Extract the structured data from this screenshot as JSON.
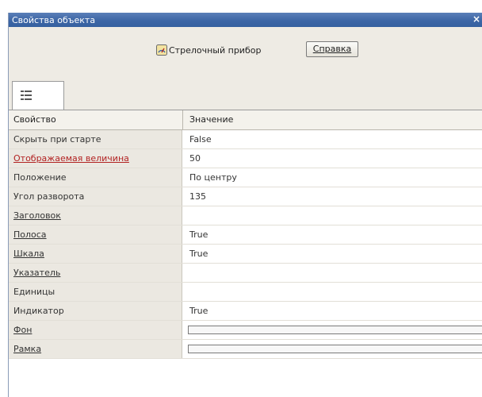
{
  "window": {
    "title": "Свойства объекта",
    "close_glyph": "×"
  },
  "header": {
    "object_label": "Стрелочный прибор",
    "help_label": "Справка",
    "object_icon": "gauge-icon"
  },
  "tabs": [
    {
      "icon": "property-list-icon"
    }
  ],
  "grid": {
    "col_property": "Свойство",
    "col_value": "Значение",
    "rows": [
      {
        "name": "Скрыть при старте",
        "value": "False",
        "style": "plain"
      },
      {
        "name": "Отображаемая величина",
        "value": "50",
        "style": "red"
      },
      {
        "name": "Положение",
        "value": "По центру",
        "style": "plain"
      },
      {
        "name": "Угол разворота",
        "value": "135",
        "style": "plain"
      },
      {
        "name": "Заголовок",
        "value": "",
        "style": "link"
      },
      {
        "name": "Полоса",
        "value": "True",
        "style": "link"
      },
      {
        "name": "Шкала",
        "value": "True",
        "style": "link"
      },
      {
        "name": "Указатель",
        "value": "",
        "style": "link"
      },
      {
        "name": "Единицы",
        "value": "",
        "style": "plain"
      },
      {
        "name": "Индикатор",
        "value": "True",
        "style": "plain"
      },
      {
        "name": "Фон",
        "value": "",
        "style": "link",
        "has_slot": true
      },
      {
        "name": "Рамка",
        "value": "",
        "style": "link",
        "has_slot": true
      }
    ]
  }
}
